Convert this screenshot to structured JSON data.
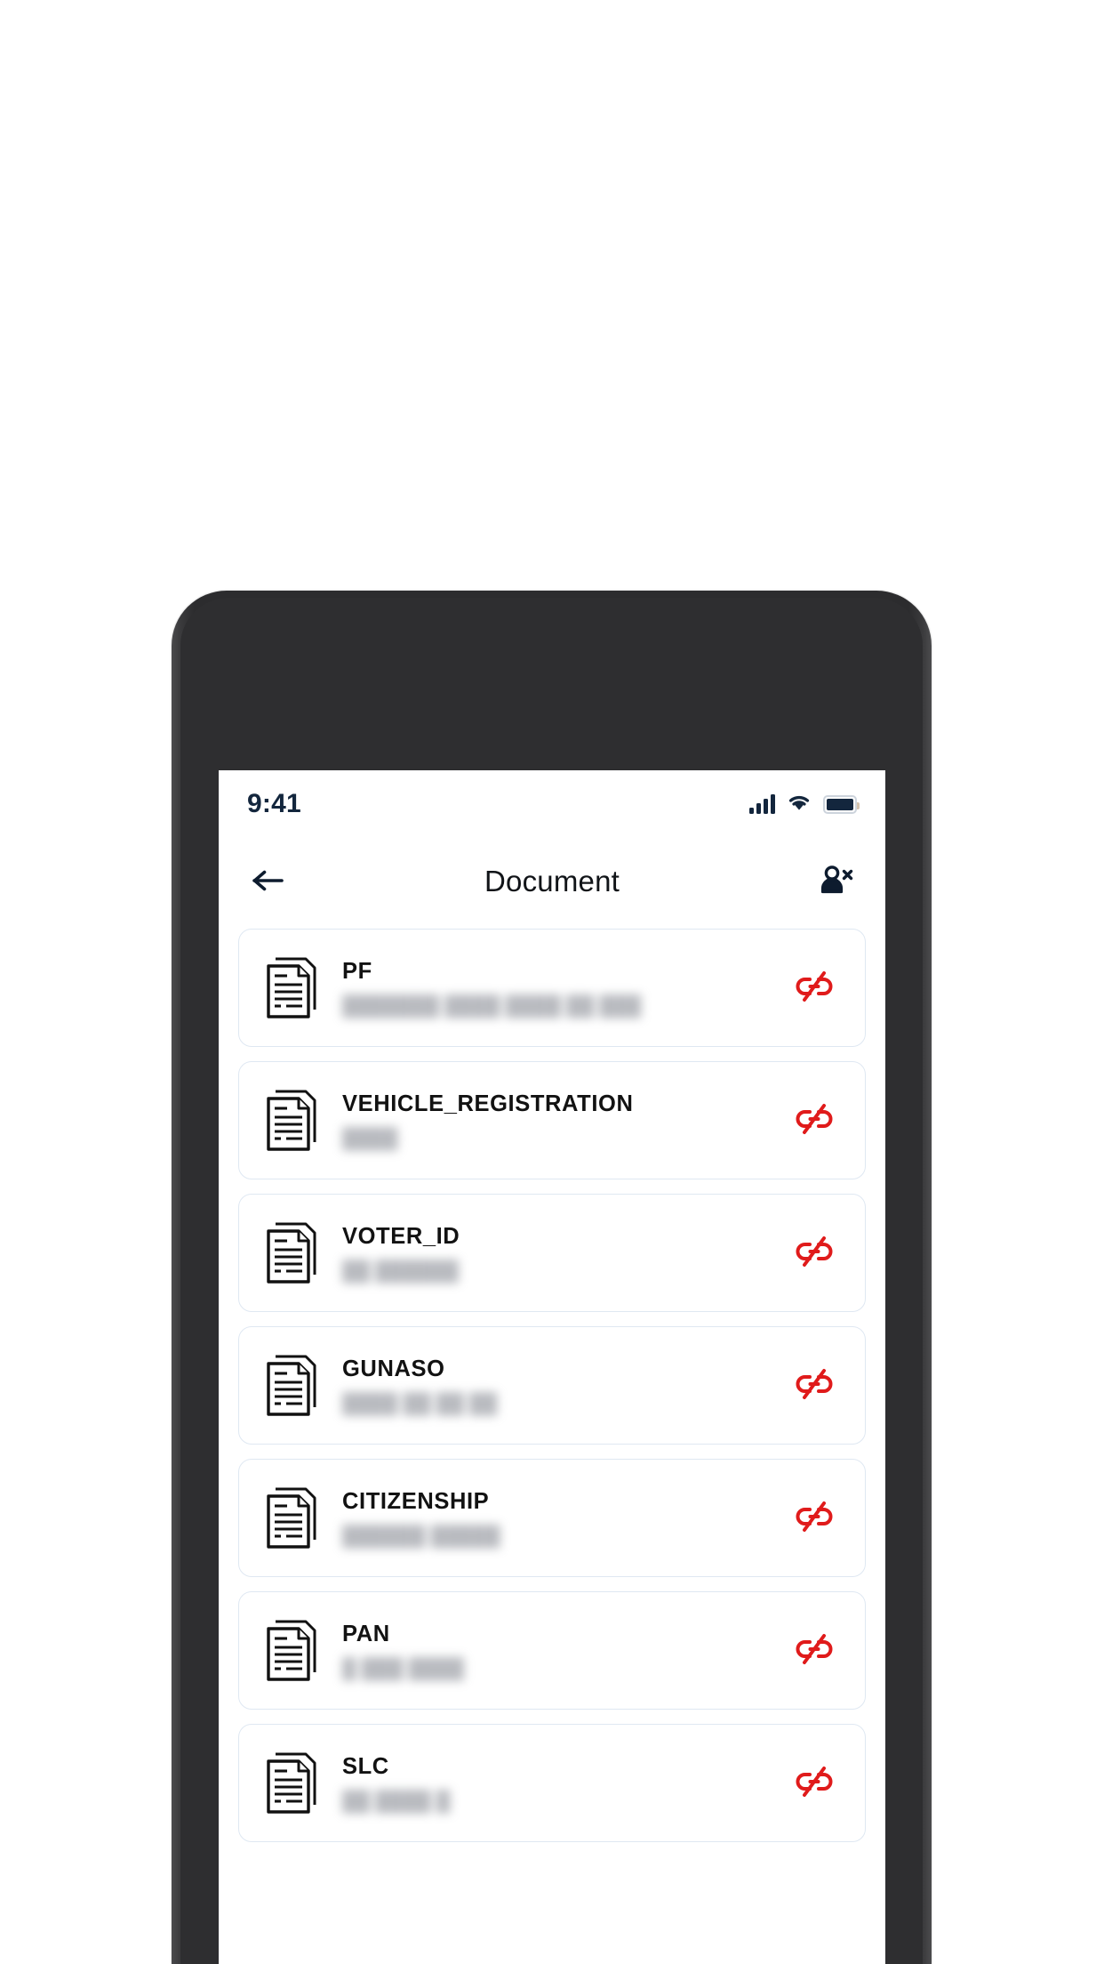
{
  "device": {
    "frame_color": "#2c2c2e"
  },
  "status_bar": {
    "time": "9:41",
    "signal_icon": "cellular-signal-icon",
    "wifi_icon": "wifi-icon",
    "battery_icon": "battery-full-icon",
    "icon_color": "#13263d"
  },
  "header": {
    "back_icon": "arrow-left-icon",
    "title": "Document",
    "action_icon": "user-remove-icon"
  },
  "colors": {
    "card_border": "#dfe8f2",
    "title_text": "#121212",
    "subtitle_text": "#8e9199",
    "unlink_red": "#e01b1b",
    "header_text": "#111418"
  },
  "documents": [
    {
      "name": "PF",
      "detail": "███████ ████ ████ ██ ███",
      "icon": "document-icon",
      "action_icon": "unlink-icon"
    },
    {
      "name": "VEHICLE_REGISTRATION",
      "detail": "████",
      "icon": "document-icon",
      "action_icon": "unlink-icon"
    },
    {
      "name": "VOTER_ID",
      "detail": "██ ██████",
      "icon": "document-icon",
      "action_icon": "unlink-icon"
    },
    {
      "name": "GUNASO",
      "detail": "████ ██ ██ ██",
      "icon": "document-icon",
      "action_icon": "unlink-icon"
    },
    {
      "name": "CITIZENSHIP",
      "detail": "██████ █████",
      "icon": "document-icon",
      "action_icon": "unlink-icon"
    },
    {
      "name": "PAN",
      "detail": "█ ███ ████",
      "icon": "document-icon",
      "action_icon": "unlink-icon"
    },
    {
      "name": "SLC",
      "detail": "██ ████ █",
      "icon": "document-icon",
      "action_icon": "unlink-icon"
    }
  ]
}
